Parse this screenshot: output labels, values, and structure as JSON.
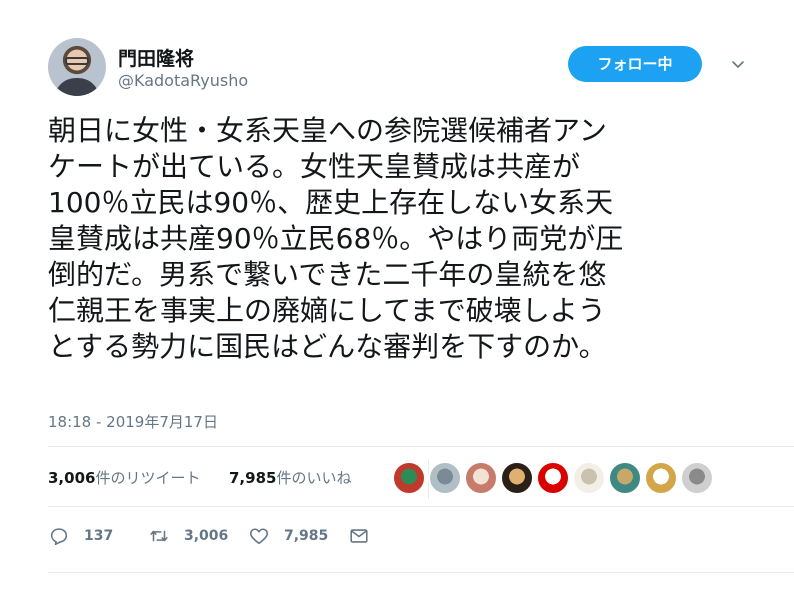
{
  "author": {
    "display_name": "門田隆将",
    "handle": "@KadotaRyusho"
  },
  "follow_button": {
    "label": "フォロー中"
  },
  "tweet": {
    "lines": [
      "朝日に女性・女系天皇への参院選候補者アン",
      "ケートが出ている。女性天皇賛成は共産が",
      "100％立民は90％、歴史上存在しない女系天",
      "皇賛成は共産90％立民68％。やはり両党が圧",
      "倒的だ。男系で繋いできた二千年の皇統を悠",
      "仁親王を事実上の廃嫡にしてまで破壊しよう",
      "とする勢力に国民はどんな審判を下すのか。"
    ],
    "timestamp": "18:18 - 2019年7月17日"
  },
  "stats": {
    "retweets_count": "3,006",
    "retweets_label": "件のリツイート",
    "likes_count": "7,985",
    "likes_label": "件のいいね"
  },
  "likers": [
    {
      "color_a": "#c0392b",
      "color_b": "#2e8b57"
    },
    {
      "color_a": "#b0bec5",
      "color_b": "#7b8a96"
    },
    {
      "color_a": "#c77b6a",
      "color_b": "#f3e2d4"
    },
    {
      "color_a": "#2b2016",
      "color_b": "#e0b070"
    },
    {
      "color_a": "#d90000",
      "color_b": "#ffffff"
    },
    {
      "color_a": "#f2efe6",
      "color_b": "#c9c2ad"
    },
    {
      "color_a": "#3e8a82",
      "color_b": "#c8a86a"
    },
    {
      "color_a": "#d4a64a",
      "color_b": "#ffffff"
    },
    {
      "color_a": "#cfcfcf",
      "color_b": "#8a8a8a"
    }
  ],
  "actions": {
    "reply_count": "137",
    "retweet_count": "3,006",
    "like_count": "7,985"
  },
  "colors": {
    "accent": "#1da1f2",
    "muted": "#657786",
    "text": "#14171a"
  }
}
